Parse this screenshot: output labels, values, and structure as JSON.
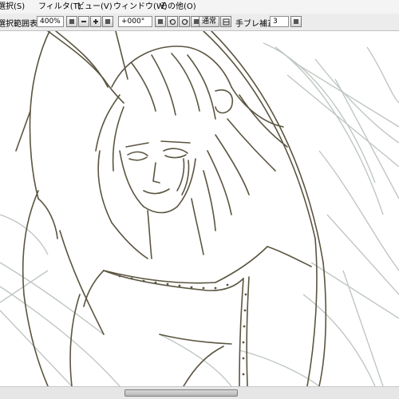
{
  "menu": {
    "items": [
      {
        "label": "選択(S)"
      },
      {
        "label": "フィルタ(T)"
      },
      {
        "label": "ビュー(V)"
      },
      {
        "label": "ウィンドウ(W)"
      },
      {
        "label": "その他(O)"
      }
    ]
  },
  "toolbar": {
    "range_display_label": "選択範囲表示",
    "zoom_value": "400%",
    "rotation_value": "+000°",
    "blend_button_label": "通常",
    "stabilizer_label": "手ブレ補正",
    "stabilizer_value": "3",
    "icons": {
      "zoom_down": "minus-icon",
      "zoom_up": "plus-icon",
      "rotate_reset": "reset-icon",
      "rotate_left": "rotate-left-icon",
      "rotate_right": "rotate-right-icon",
      "flip": "flip-icon",
      "stabilizer_dropdown": "dropdown-icon"
    }
  },
  "canvas": {
    "line_art_color": "#5b5540",
    "sketch_color": "#b9c2bb"
  },
  "scrollbar": {
    "position_fraction": 0.31,
    "visible_fraction": 0.28
  }
}
